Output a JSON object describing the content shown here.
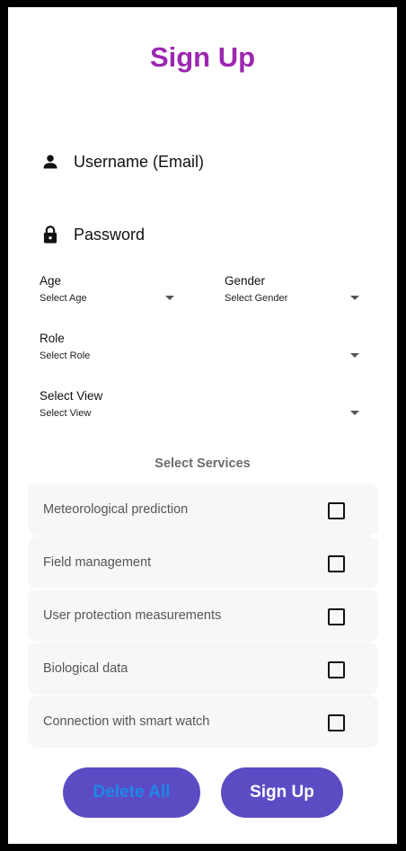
{
  "header": {
    "title": "Sign Up"
  },
  "form": {
    "username_label": "Username (Email)",
    "password_label": "Password",
    "age": {
      "label": "Age",
      "value": "Select Age"
    },
    "gender": {
      "label": "Gender",
      "value": "Select Gender"
    },
    "role": {
      "label": "Role",
      "value": "Select Role"
    },
    "view": {
      "label": "Select View",
      "value": "Select View"
    }
  },
  "services": {
    "title": "Select Services",
    "items": [
      {
        "label": "Meteorological prediction",
        "checked": false
      },
      {
        "label": "Field management",
        "checked": false
      },
      {
        "label": "User protection measurements",
        "checked": false
      },
      {
        "label": "Biological data",
        "checked": false
      },
      {
        "label": "Connection with smart watch",
        "checked": false
      }
    ]
  },
  "actions": {
    "delete_label": "Delete All",
    "signup_label": "Sign Up"
  },
  "colors": {
    "title": "#9c27b0",
    "button_bg": "#5b4cc4",
    "delete_text": "#1e88e5",
    "signup_text": "#ffffff",
    "service_bg": "#f7f7f7"
  },
  "icons": {
    "username": "person-icon",
    "password": "lock-icon",
    "dropdown": "dropdown-arrow-icon",
    "checkbox": "checkbox-unchecked-icon"
  }
}
